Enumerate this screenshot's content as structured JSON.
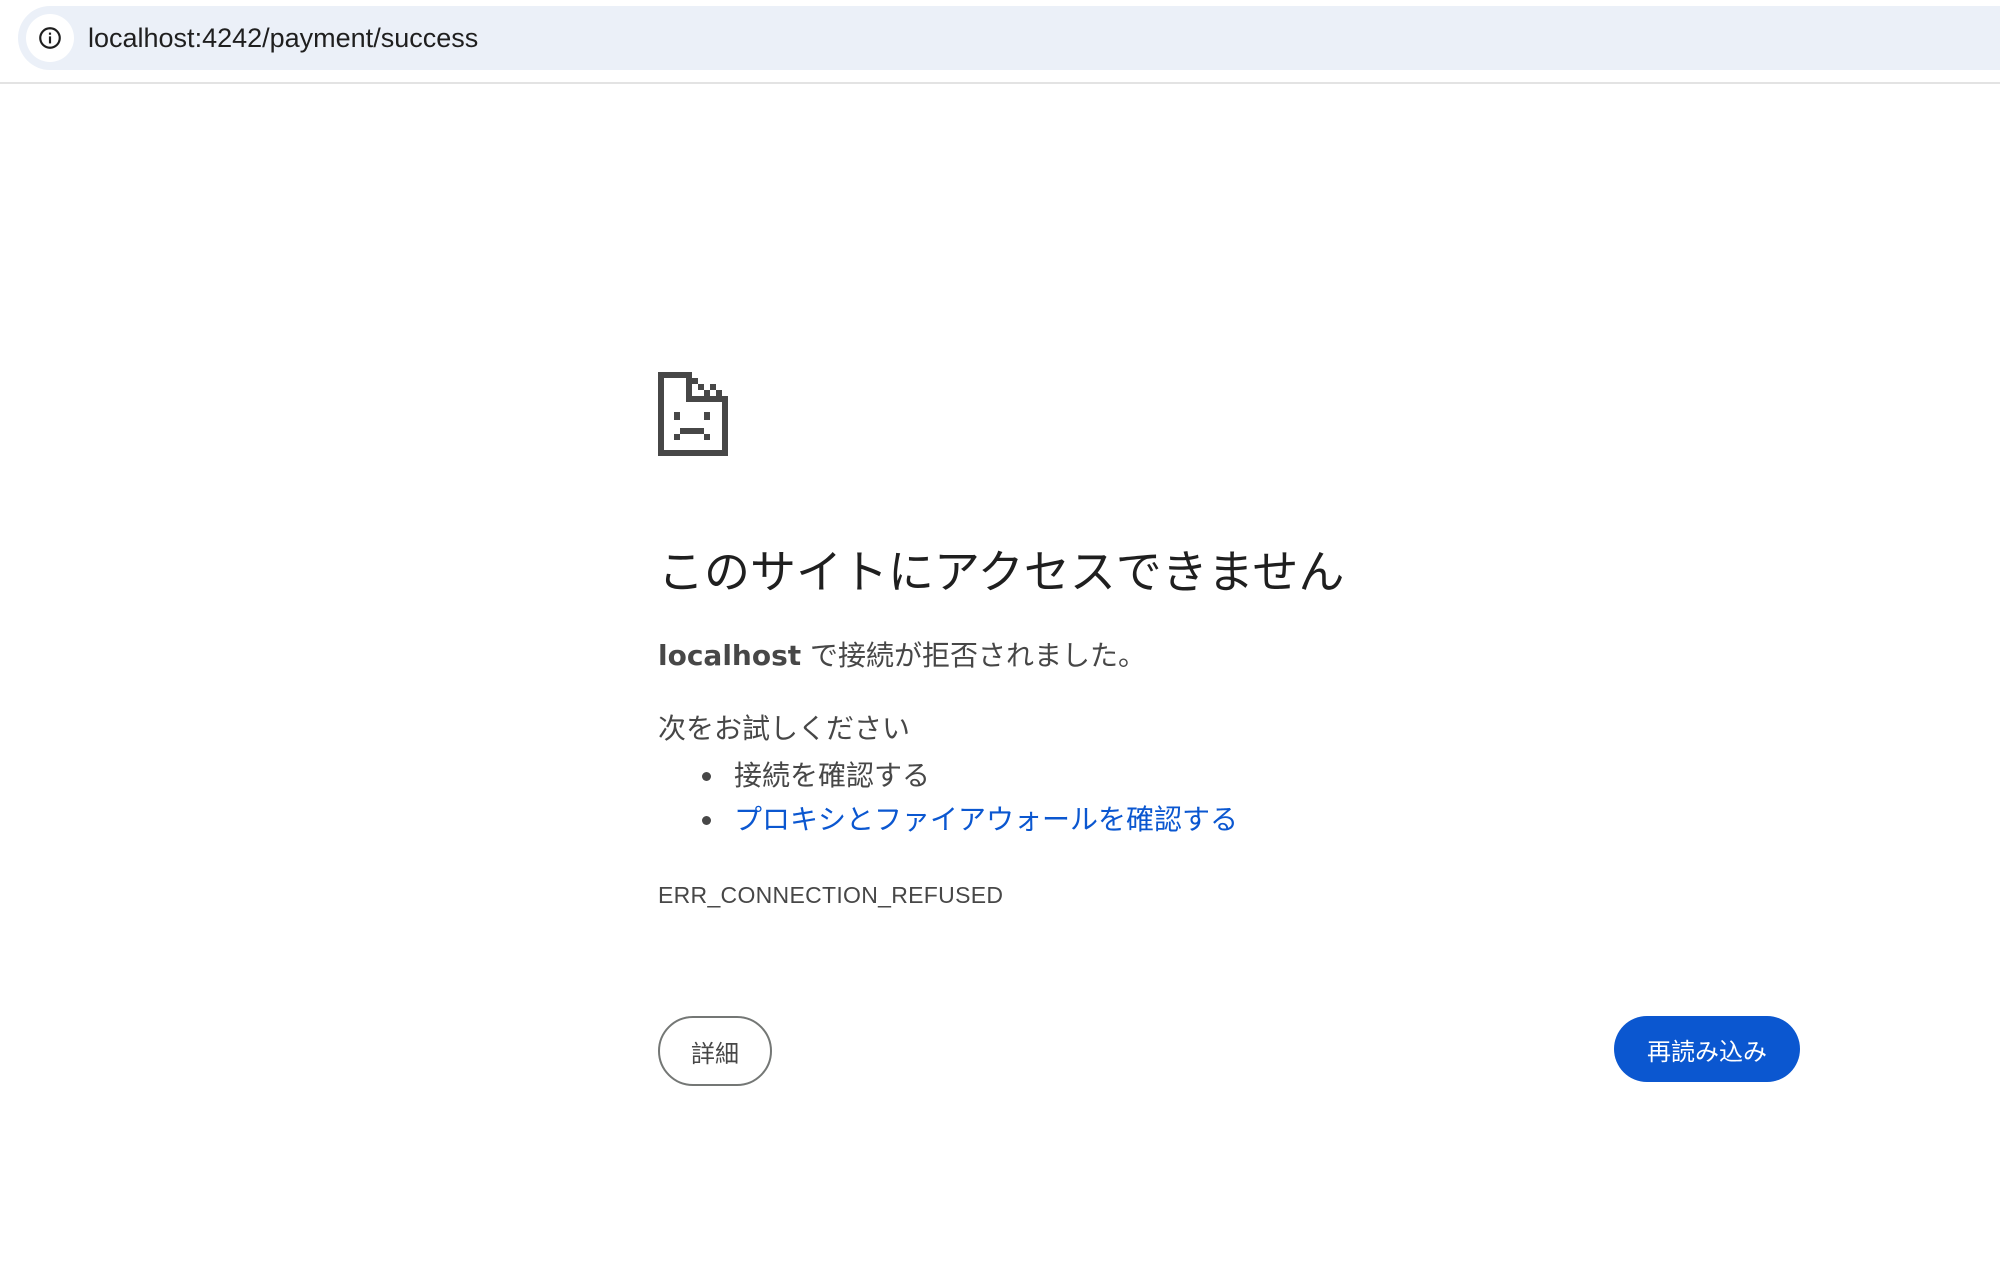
{
  "browser": {
    "url": "localhost:4242/payment/success",
    "site_info_icon": "info-circle-icon"
  },
  "error": {
    "icon": "sad-page-icon",
    "title": "このサイトにアクセスできません",
    "host": "localhost",
    "description": " で接続が拒否されました。",
    "try_label": "次をお試しください",
    "suggestions": [
      {
        "label": "接続を確認する",
        "link": false
      },
      {
        "label": "プロキシとファイアウォールを確認する",
        "link": true
      }
    ],
    "code": "ERR_CONNECTION_REFUSED"
  },
  "buttons": {
    "details_label": "詳細",
    "reload_label": "再読み込み"
  },
  "colors": {
    "accent": "#0b57d0",
    "omnibox_bg": "#ebf0f8",
    "text": "#474747"
  }
}
